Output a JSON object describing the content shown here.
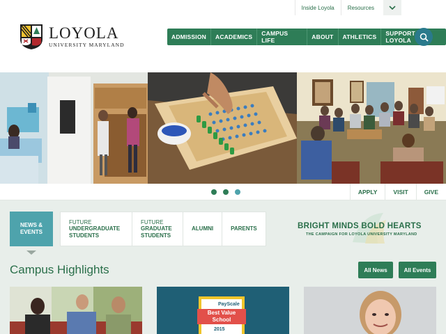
{
  "utility": {
    "links": [
      "Inside Loyola",
      "Resources"
    ]
  },
  "logo": {
    "name": "LOYOLA",
    "subtitle": "UNIVERSITY MARYLAND"
  },
  "nav": {
    "items": [
      "ADMISSION",
      "ACADEMICS",
      "CAMPUS LIFE",
      "ABOUT",
      "ATHLETICS",
      "SUPPORT LOYOLA"
    ]
  },
  "carousel": {
    "slide_count": 3,
    "actions": [
      "APPLY",
      "VISIT",
      "GIVE"
    ]
  },
  "tabs": {
    "active": {
      "line1": "NEWS &",
      "line2": "EVENTS"
    },
    "items": [
      {
        "thin": "FUTURE",
        "bold": "UNDERGRADUATE STUDENTS"
      },
      {
        "thin": "FUTURE",
        "bold": "GRADUATE STUDENTS"
      },
      {
        "single": "ALUMNI"
      },
      {
        "single": "PARENTS"
      }
    ]
  },
  "campaign": {
    "title": "BRIGHT MINDS BOLD HEARTS",
    "subtitle": "THE CAMPAIGN FOR LOYOLA UNIVERSITY MARYLAND"
  },
  "highlights": {
    "title": "Campus Highlights",
    "all_news": "All News",
    "all_events": "All Events"
  },
  "cards": {
    "badge_brand": "PayScale",
    "badge_line1": "Best Value",
    "badge_line2": "School",
    "badge_year": "2015"
  },
  "colors": {
    "brand_green": "#2e7d57",
    "accent_teal": "#4ea3ac"
  }
}
